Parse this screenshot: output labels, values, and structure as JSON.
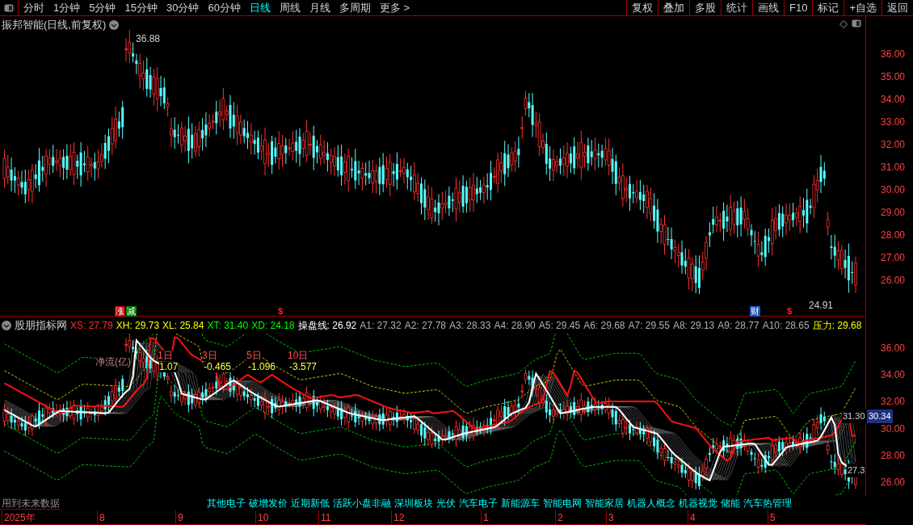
{
  "toolbar": {
    "tabs": [
      {
        "label": "分时",
        "selected": false
      },
      {
        "label": "1分钟",
        "selected": false
      },
      {
        "label": "5分钟",
        "selected": false
      },
      {
        "label": "15分钟",
        "selected": false
      },
      {
        "label": "30分钟",
        "selected": false
      },
      {
        "label": "60分钟",
        "selected": false
      },
      {
        "label": "日线",
        "selected": true
      },
      {
        "label": "周线",
        "selected": false
      },
      {
        "label": "月线",
        "selected": false
      },
      {
        "label": "多周期",
        "selected": false
      },
      {
        "label": "更多 >",
        "selected": false
      }
    ],
    "buttons": [
      "复权",
      "叠加",
      "多股",
      "统计",
      "画线",
      "F10",
      "标记",
      "+自选",
      "返回"
    ]
  },
  "main_chart": {
    "title": "振邦智能(日线,前复权)",
    "price_axis": [
      "36.00",
      "35.00",
      "34.00",
      "33.00",
      "32.00",
      "31.00",
      "30.00",
      "29.00",
      "28.00",
      "27.00",
      "26.00"
    ],
    "high_label": "36.88",
    "low_label": "24.91",
    "markers": [
      {
        "label": "涨",
        "kind": "rise"
      },
      {
        "label": "减",
        "kind": "reduce"
      },
      {
        "label": "$",
        "kind": "dollar"
      },
      {
        "label": "财",
        "kind": "finance"
      },
      {
        "label": "$",
        "kind": "dollar"
      }
    ]
  },
  "indicator": {
    "name": "股朋指标网",
    "readings": [
      {
        "text": "XS: 27.79",
        "color": "#ff3030"
      },
      {
        "text": "XH: 29.73",
        "color": "#ffff00"
      },
      {
        "text": "XL: 25.84",
        "color": "#ffff00"
      },
      {
        "text": "XT: 31.40",
        "color": "#00ff00"
      },
      {
        "text": "XD: 24.18",
        "color": "#00ff00"
      },
      {
        "text": "操盘线: 26.92",
        "color": "#ffffff"
      },
      {
        "text": "A1: 27.32",
        "color": "#b0b0b0"
      },
      {
        "text": "A2: 27.78",
        "color": "#b0b0b0"
      },
      {
        "text": "A3: 28.33",
        "color": "#b0b0b0"
      },
      {
        "text": "A4: 28.90",
        "color": "#b0b0b0"
      },
      {
        "text": "A5: 29.45",
        "color": "#b0b0b0"
      },
      {
        "text": "A6: 29.68",
        "color": "#b0b0b0"
      },
      {
        "text": "A7: 29.55",
        "color": "#b0b0b0"
      },
      {
        "text": "A8: 29.13",
        "color": "#b0b0b0"
      },
      {
        "text": "A9: 28.77",
        "color": "#b0b0b0"
      },
      {
        "text": "A10: 28.65",
        "color": "#b0b0b0"
      },
      {
        "text": "压力: 29.68",
        "color": "#ffff00"
      }
    ],
    "flow_label": "净流(亿)",
    "flows": [
      {
        "period": "1日",
        "value": "1.07"
      },
      {
        "period": "3日",
        "value": "-0.465"
      },
      {
        "period": "5日",
        "value": "-1.096"
      },
      {
        "period": "10日",
        "value": "-3.577"
      }
    ],
    "price_axis": [
      "36.00",
      "34.00",
      "32.00",
      "30.00",
      "28.00",
      "26.00"
    ],
    "right_labels": {
      "upper": "31.30",
      "current": "30.34",
      "lower": "27.3"
    },
    "note": "用到未来数据",
    "concepts": [
      "其他电子",
      "破增发价",
      "近期新低",
      "活跃小盘非融",
      "深圳板块",
      "光伏",
      "汽车电子",
      "新能源车",
      "智能电网",
      "智能家居",
      "机器人概念",
      "机器视觉",
      "储能",
      "汽车热管理"
    ]
  },
  "date_axis": [
    "2025年",
    "8",
    "9",
    "10",
    "11",
    "12",
    "1",
    "2",
    "3",
    "4",
    "5"
  ]
}
